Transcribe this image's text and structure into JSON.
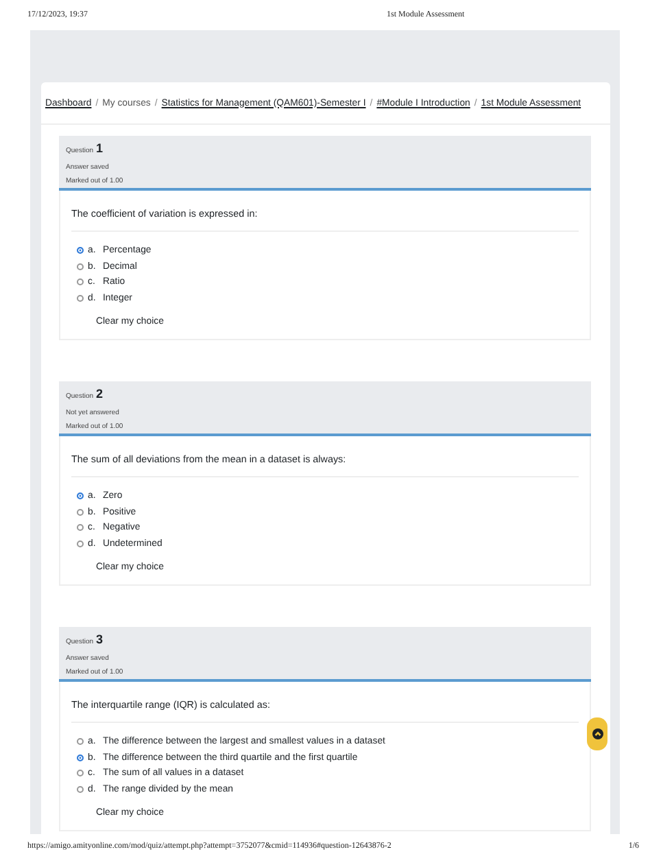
{
  "print_header": {
    "datetime": "17/12/2023, 19:37",
    "title": "1st Module Assessment"
  },
  "breadcrumb": {
    "separator": "/",
    "items": [
      {
        "label": "Dashboard",
        "link": true
      },
      {
        "label": "My courses",
        "link": false
      },
      {
        "label": "Statistics for Management (QAM601)-Semester I",
        "link": true
      },
      {
        "label": "#Module I Introduction",
        "link": true
      },
      {
        "label": "1st Module Assessment",
        "link": true
      }
    ]
  },
  "questions": [
    {
      "label": "Question",
      "number": "1",
      "status": "Answer saved",
      "marks": "Marked out of 1.00",
      "text": "The coefficient of variation is expressed in:",
      "clear_label": "Clear my choice",
      "options": [
        {
          "letter": "a.",
          "text": "Percentage",
          "selected": true
        },
        {
          "letter": "b.",
          "text": "Decimal",
          "selected": false
        },
        {
          "letter": "c.",
          "text": "Ratio",
          "selected": false
        },
        {
          "letter": "d.",
          "text": "Integer",
          "selected": false
        }
      ]
    },
    {
      "label": "Question",
      "number": "2",
      "status": "Not yet answered",
      "marks": "Marked out of 1.00",
      "text": "The sum of all deviations from the mean in a dataset is always:",
      "clear_label": "Clear my choice",
      "options": [
        {
          "letter": "a.",
          "text": "Zero",
          "selected": true
        },
        {
          "letter": "b.",
          "text": "Positive",
          "selected": false
        },
        {
          "letter": "c.",
          "text": "Negative",
          "selected": false
        },
        {
          "letter": "d.",
          "text": "Undetermined",
          "selected": false
        }
      ]
    },
    {
      "label": "Question",
      "number": "3",
      "status": "Answer saved",
      "marks": "Marked out of 1.00",
      "text": "The interquartile range (IQR) is calculated as:",
      "clear_label": "Clear my choice",
      "options": [
        {
          "letter": "a.",
          "text": "The difference between the largest and smallest values in a dataset",
          "selected": false
        },
        {
          "letter": "b.",
          "text": "The difference between the third quartile and the first quartile",
          "selected": true
        },
        {
          "letter": "c.",
          "text": "The sum of all values in a dataset",
          "selected": false
        },
        {
          "letter": "d.",
          "text": "The range divided by the mean",
          "selected": false
        }
      ]
    }
  ],
  "print_footer": {
    "url": "https://amigo.amityonline.com/mod/quiz/attempt.php?attempt=3752077&cmid=114936#question-12643876-2",
    "page": "1/6"
  }
}
